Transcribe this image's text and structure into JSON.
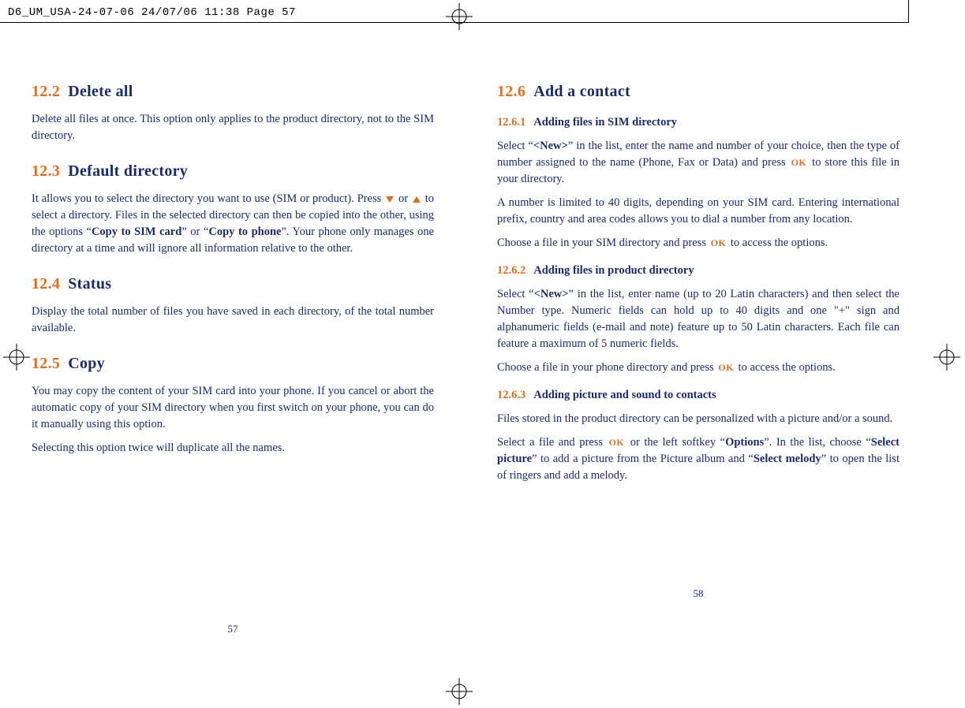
{
  "slug": "D6_UM_USA-24-07-06  24/07/06  11:38  Page 57",
  "icons": {
    "ok": "OK"
  },
  "left": {
    "pagenum": "57",
    "s1": {
      "num": "12.2",
      "title": "Delete all",
      "p1": "Delete all files at once. This option only applies to the product directory, not to the SIM directory."
    },
    "s2": {
      "num": "12.3",
      "title": "Default directory",
      "p1a": "It allows you to select the directory you want to use (SIM or product). Press ",
      "p1b": " or ",
      "p1c": " to select a directory. Files in the selected directory can then be copied into the other, using the options “",
      "p1bold1": "Copy to SIM card",
      "p1d": "” or “",
      "p1bold2": "Copy to phone",
      "p1e": "”. Your phone only manages one directory at a time and will ignore all information relative to the other."
    },
    "s3": {
      "num": "12.4",
      "title": "Status",
      "p1": "Display the total number of files you have saved in each directory, of the total number available."
    },
    "s4": {
      "num": "12.5",
      "title": "Copy",
      "p1": "You may copy the content of your SIM card into your phone. If you cancel or abort the automatic copy of your SIM directory when you first switch on your phone, you can do it manually using this option.",
      "p2": "Selecting this option twice will duplicate all the names."
    }
  },
  "right": {
    "pagenum": "58",
    "s1": {
      "num": "12.6",
      "title": "Add a contact"
    },
    "sub1": {
      "num": "12.6.1",
      "title": "Adding files in SIM directory",
      "p1a": "Select “",
      "p1bold": "<New>",
      "p1b": "” in the list, enter the name and number of your choice, then the type of number assigned to the name (Phone, Fax or Data) and press ",
      "p1c": " to store this file in your directory.",
      "p2": "A number is limited to 40 digits, depending on your SIM card. Entering international prefix, country and area codes allows you to dial a number from any location.",
      "p3a": "Choose a file in your SIM directory and press ",
      "p3b": " to access the options."
    },
    "sub2": {
      "num": "12.6.2",
      "title": "Adding files in product directory",
      "p1a": "Select “",
      "p1bold": "<New>",
      "p1b": "” in the list, enter name (up to 20 Latin characters) and then select the Number type. Numeric fields can hold up to 40 digits and one \"+\" sign and alphanumeric fields (e-mail and note) feature up to 50 Latin characters. Each file can feature a maximum of 5 numeric fields.",
      "p2a": "Choose a file in your phone directory and press ",
      "p2b": " to access the options."
    },
    "sub3": {
      "num": "12.6.3",
      "title": "Adding picture and sound to contacts",
      "p1": "Files stored in the product directory can be personalized with a picture and/or a sound.",
      "p2a": "Select a file and press ",
      "p2b": " or the left softkey “",
      "p2bold1": "Options",
      "p2c": "”. In the list, choose “",
      "p2bold2": "Select picture",
      "p2d": "” to add a picture from the Picture album and “",
      "p2bold3": "Select melody",
      "p2e": "” to open the list of ringers and add a melody."
    }
  }
}
